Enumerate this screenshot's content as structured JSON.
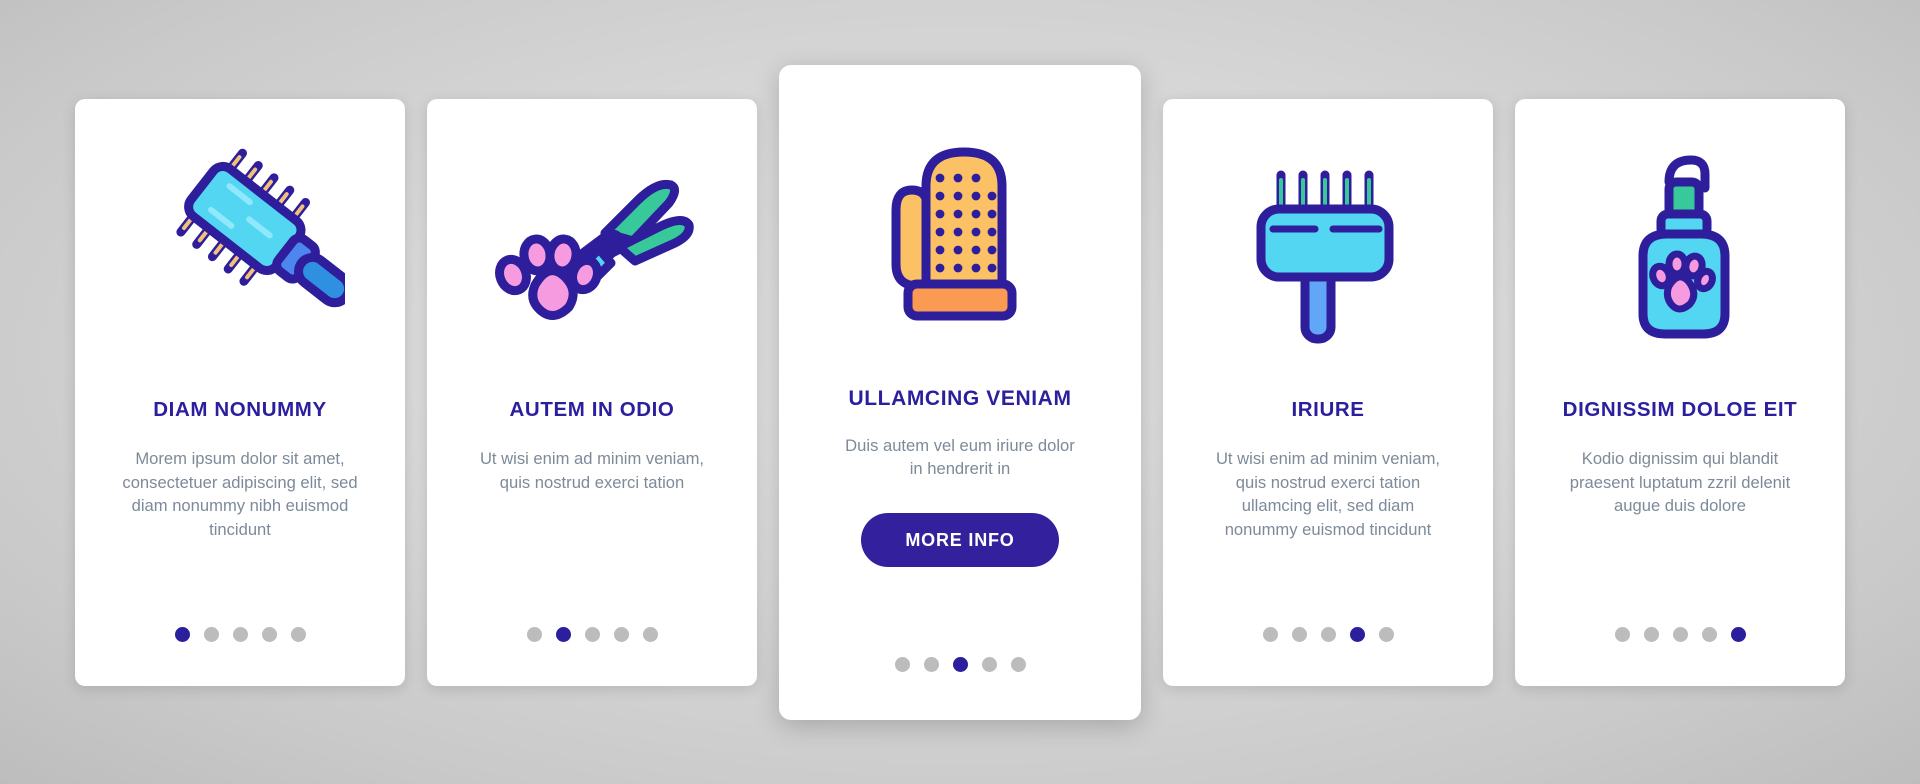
{
  "background": {
    "color": "#d6d6d6"
  },
  "theme": {
    "primary": "#2b1f9e",
    "button_bg": "#32209c",
    "body_text": "#7d8a99",
    "dot_inactive": "#bcbcbc",
    "dot_active": "#2b1f9e",
    "card_bg": "#ffffff"
  },
  "cards": [
    {
      "icon": "pet-slicker-brush-icon",
      "title": "DIAM NONUMMY",
      "body": "Morem ipsum dolor sit amet, consectetuer adipiscing elit, sed diam nonummy nibh euismod tincidunt",
      "dots": 5,
      "active_dot": 1,
      "featured": false,
      "button": null
    },
    {
      "icon": "nail-clipper-paw-icon",
      "title": "AUTEM IN ODIO",
      "body": "Ut wisi enim ad minim veniam, quis nostrud exerci tation",
      "dots": 5,
      "active_dot": 2,
      "featured": false,
      "button": null
    },
    {
      "icon": "grooming-glove-icon",
      "title": "ULLAMCING VENIAM",
      "body": "Duis autem vel eum iriure dolor in hendrerit in",
      "dots": 5,
      "active_dot": 3,
      "featured": true,
      "button": "MORE INFO"
    },
    {
      "icon": "pet-rake-comb-icon",
      "title": "IRIURE",
      "body": "Ut wisi enim ad minim veniam, quis nostrud exerci tation ullamcing elit, sed diam nonummy euismod tincidunt",
      "dots": 5,
      "active_dot": 4,
      "featured": false,
      "button": null
    },
    {
      "icon": "pet-shampoo-bottle-icon",
      "title": "DIGNISSIM DOLOE EIT",
      "body": "Kodio dignissim qui blandit praesent luptatum zzril delenit augue duis dolore",
      "dots": 5,
      "active_dot": 5,
      "featured": false,
      "button": null
    }
  ]
}
